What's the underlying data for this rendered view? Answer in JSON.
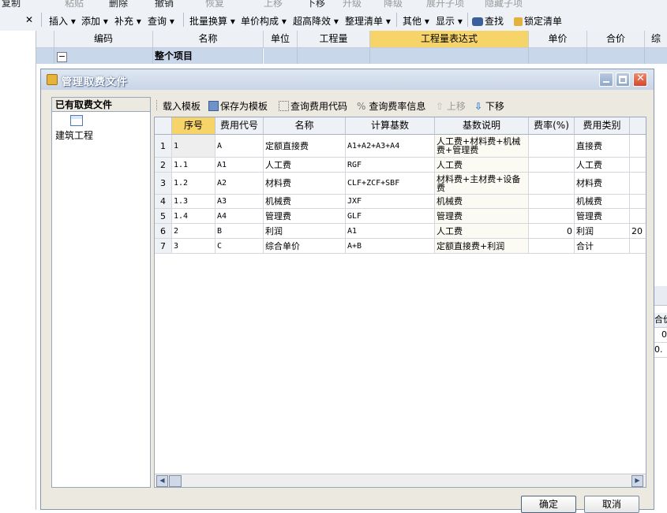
{
  "top_toolbar": {
    "row0": [
      "复制",
      "粘贴",
      "删除",
      "撤销",
      "恢复",
      "上移",
      "下移",
      "升级",
      "降级",
      "展开子项",
      "隐藏子项"
    ],
    "row1": [
      "插入",
      "添加",
      "补充",
      "查询",
      "批量换算",
      "单价构成",
      "超高降效",
      "整理清单",
      "其他",
      "显示",
      "查找",
      "锁定清单"
    ]
  },
  "bg_grid": {
    "headers": [
      "编码",
      "名称",
      "单位",
      "工程量",
      "工程量表达式",
      "单价",
      "合价",
      "综"
    ],
    "row0_name": "整个项目",
    "row0_sign": "−",
    "right_labels": [
      "合价",
      "0",
      "0."
    ]
  },
  "dialog": {
    "title": "管理取费文件",
    "left_panel_title": "已有取费文件",
    "tree_item": "建筑工程",
    "toolbar": [
      "载入模板",
      "保存为模板",
      "查询费用代码",
      "查询费率信息",
      "上移",
      "下移"
    ],
    "columns": [
      "序号",
      "费用代号",
      "名称",
      "计算基数",
      "基数说明",
      "费率(%)",
      "费用类别"
    ],
    "rows": [
      {
        "rn": "1",
        "seq": "1",
        "code": "A",
        "name": "定额直接费",
        "base": "A1+A2+A3+A4",
        "desc": "人工费+材料费+机械费+管理费",
        "rate": "",
        "type": "直接费",
        "extra": ""
      },
      {
        "rn": "2",
        "seq": "1.1",
        "code": "A1",
        "name": "人工费",
        "base": "RGF",
        "desc": "人工费",
        "rate": "",
        "type": "人工费",
        "extra": ""
      },
      {
        "rn": "3",
        "seq": "1.2",
        "code": "A2",
        "name": "材料费",
        "base": "CLF+ZCF+SBF",
        "desc": "材料费+主材费+设备费",
        "rate": "",
        "type": "材料费",
        "extra": ""
      },
      {
        "rn": "4",
        "seq": "1.3",
        "code": "A3",
        "name": "机械费",
        "base": "JXF",
        "desc": "机械费",
        "rate": "",
        "type": "机械费",
        "extra": ""
      },
      {
        "rn": "5",
        "seq": "1.4",
        "code": "A4",
        "name": "管理费",
        "base": "GLF",
        "desc": "管理费",
        "rate": "",
        "type": "管理费",
        "extra": ""
      },
      {
        "rn": "6",
        "seq": "2",
        "code": "B",
        "name": "利润",
        "base": "A1",
        "desc": "人工费",
        "rate": "0",
        "type": "利润",
        "extra": "20"
      },
      {
        "rn": "7",
        "seq": "3",
        "code": "C",
        "name": "综合单价",
        "base": "A+B",
        "desc": "定额直接费+利润",
        "rate": "",
        "type": "合计",
        "extra": ""
      }
    ],
    "ok_label": "确定",
    "cancel_label": "取消"
  },
  "colors": {
    "accent_header": "#f7d46a",
    "title_bar": "#c9d5e6",
    "close_button": "#e0533a"
  }
}
